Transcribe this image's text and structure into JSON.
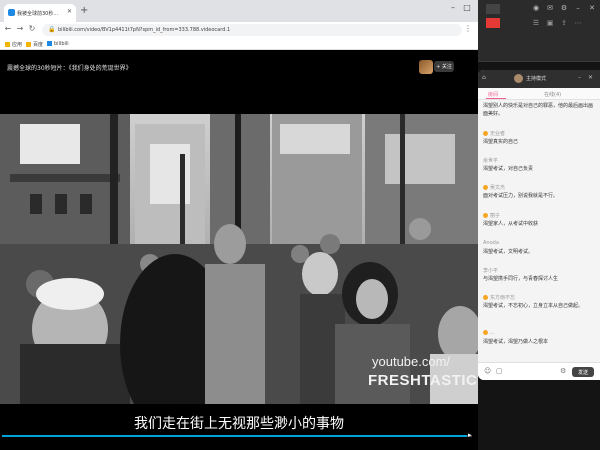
{
  "browser": {
    "tab": {
      "title": "我被全球前30秒..."
    },
    "url": "bilibili.com/video/BV1p4411t7pN?spm_id_from=333.788.videocard.1",
    "bookmarks": [
      {
        "label": "应用"
      },
      {
        "label": "百度"
      },
      {
        "label": "bilibili"
      }
    ]
  },
  "video": {
    "title": "震撼全球的30秒短片：《我们身处的荒诞世界》",
    "follow_label": "+ 关注",
    "watermark_line1": "youtube.com/",
    "watermark_line2": "FRESHTASTICAL",
    "subtitle": "我们走在街上无视那些渺小的事物",
    "progress": 0.99
  },
  "chat": {
    "header_name": "主持模式",
    "tabs": [
      {
        "label": "房间"
      },
      {
        "label": "在线(4)"
      }
    ],
    "messages": [
      {
        "name": "",
        "text": "渴望别人的快乐是对自己的罪恶，他的最后画出画面美好。"
      },
      {
        "name": "无业者",
        "text": "渴望真实的自己"
      },
      {
        "name": "余世平",
        "text": "渴望考试，对自己负责"
      },
      {
        "name": "吴文杰",
        "text": "面对考试压力，别说我就是不行。"
      },
      {
        "name": "丽子",
        "text": "渴望家人，从考试中收获"
      },
      {
        "name": "Anoda",
        "text": "渴望考试，文明考试。"
      },
      {
        "name": "李小平",
        "text": "与渴望携手同行，与青春探讨人生"
      },
      {
        "name": "东方雨不忘",
        "text": "渴望考试，不忘初心，立身立本从自己做起。"
      },
      {
        "name": "...",
        "text": "渴望考试，渴望乃做人之根本"
      }
    ],
    "send_label": "发送"
  },
  "colors": {
    "accent": "#f25d8e",
    "progress": "#00a1d6"
  }
}
